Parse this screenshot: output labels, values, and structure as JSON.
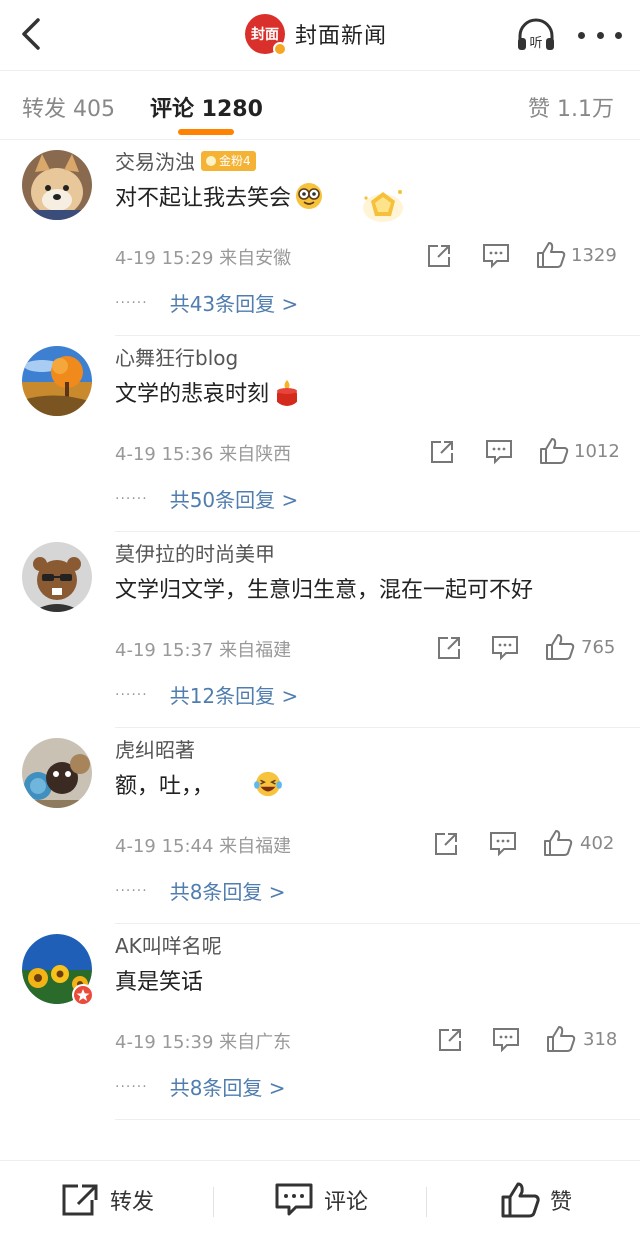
{
  "header": {
    "brand_logo_text": "封面",
    "title": "封面新闻",
    "listen_label": "听"
  },
  "tabs": {
    "repost": "转发 405",
    "comments": "评论 1280",
    "likes": "赞 1.1万"
  },
  "comments": [
    {
      "username": "交易沩浊",
      "badge": "金粉4",
      "text": "对不起让我去笑会",
      "emoji": "nerd-face-emoji",
      "time_location": "4-19 15:29  来自安徽",
      "likes": "1329",
      "replies": "共43条回复 >"
    },
    {
      "username": "心舞狂行blog",
      "badge": "",
      "text": "文学的悲哀时刻",
      "emoji": "candle-emoji",
      "time_location": "4-19 15:36  来自陕西",
      "likes": "1012",
      "replies": "共50条回复 >"
    },
    {
      "username": "莫伊拉的时尚美甲",
      "badge": "",
      "text": "文学归文学，生意归生意，混在一起可不好",
      "emoji": "",
      "time_location": "4-19 15:37  来自福建",
      "likes": "765",
      "replies": "共12条回复 >"
    },
    {
      "username": "虎纠昭著",
      "badge": "",
      "text": "额，吐，，",
      "emoji": "laughing-tears-emoji",
      "time_location": "4-19 15:44  来自福建",
      "likes": "402",
      "replies": "共8条回复 >"
    },
    {
      "username": "AK叫咩名呢",
      "badge": "",
      "text": "真是笑话",
      "emoji": "",
      "time_location": "4-19 15:39  来自广东",
      "likes": "318",
      "replies": "共8条回复 >"
    }
  ],
  "bottom_bar": {
    "repost": "转发",
    "comment": "评论",
    "like": "赞"
  },
  "colors": {
    "accent_orange": "#ff8200",
    "brand_red": "#d9302b",
    "reply_link": "#507daf"
  }
}
